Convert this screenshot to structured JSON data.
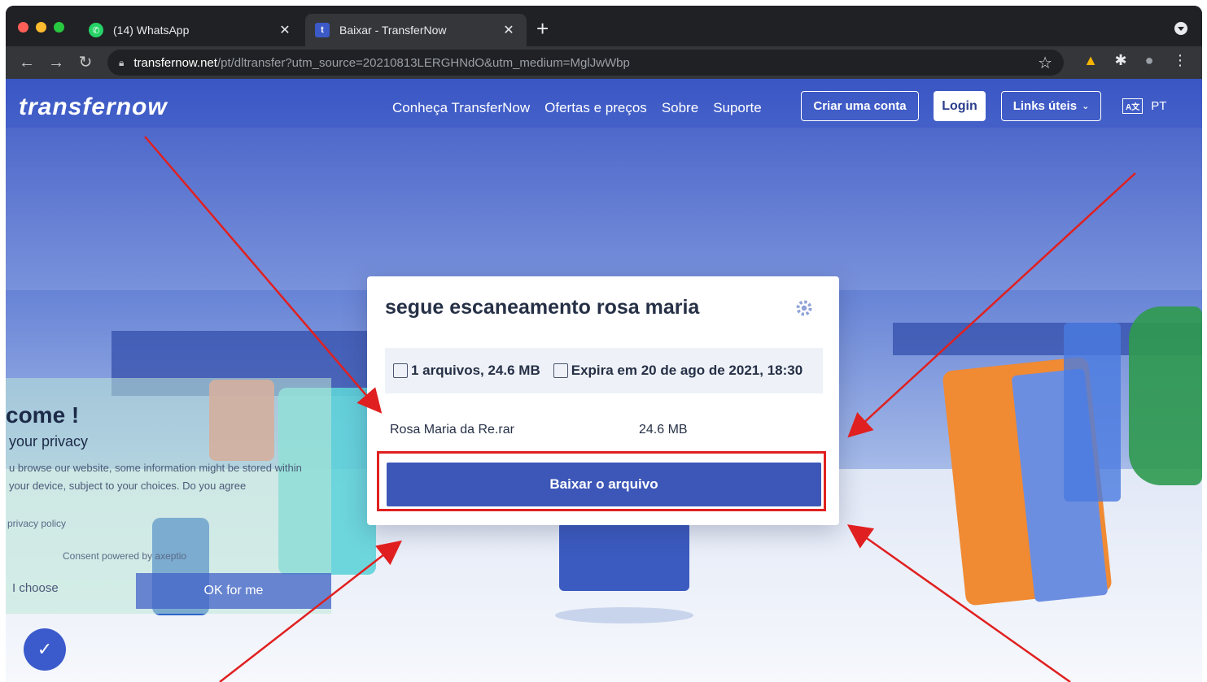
{
  "browser": {
    "tabs": [
      {
        "title": "(14) WhatsApp",
        "favicon": "whatsapp-icon"
      },
      {
        "title": "Baixar - TransferNow",
        "favicon": "transfernow-icon"
      }
    ],
    "new_tab": "+",
    "url_host": "transfernow.net",
    "url_path": "/pt/dltransfer?utm_source=20210813LERGHNdO&utm_medium=MglJwWbp"
  },
  "site": {
    "logo": "transfernow",
    "nav": [
      "Conheça TransferNow",
      "Ofertas e preços",
      "Sobre",
      "Suporte"
    ],
    "create_account": "Criar uma conta",
    "login": "Login",
    "links": "Links úteis",
    "lang": "PT"
  },
  "card": {
    "title": "segue escaneamento rosa maria",
    "files_info": "1 arquivos, 24.6 MB",
    "expiry": "Expira em 20 de ago de 2021, 18:30",
    "file_name": "Rosa Maria da Re.rar",
    "file_size": "24.6 MB",
    "download_button": "Baixar o arquivo"
  },
  "cookie": {
    "welcome": "come !",
    "privacy": "your privacy",
    "description": "u browse our website, some information might be stored within your device, subject to your choices. Do you agree",
    "policy": "privacy policy",
    "powered": "Consent powered by axeptio",
    "choose": "I choose",
    "ok": "OK for me"
  },
  "colors": {
    "brand_blue": "#3d57b8",
    "annotation_red": "#e02020"
  }
}
